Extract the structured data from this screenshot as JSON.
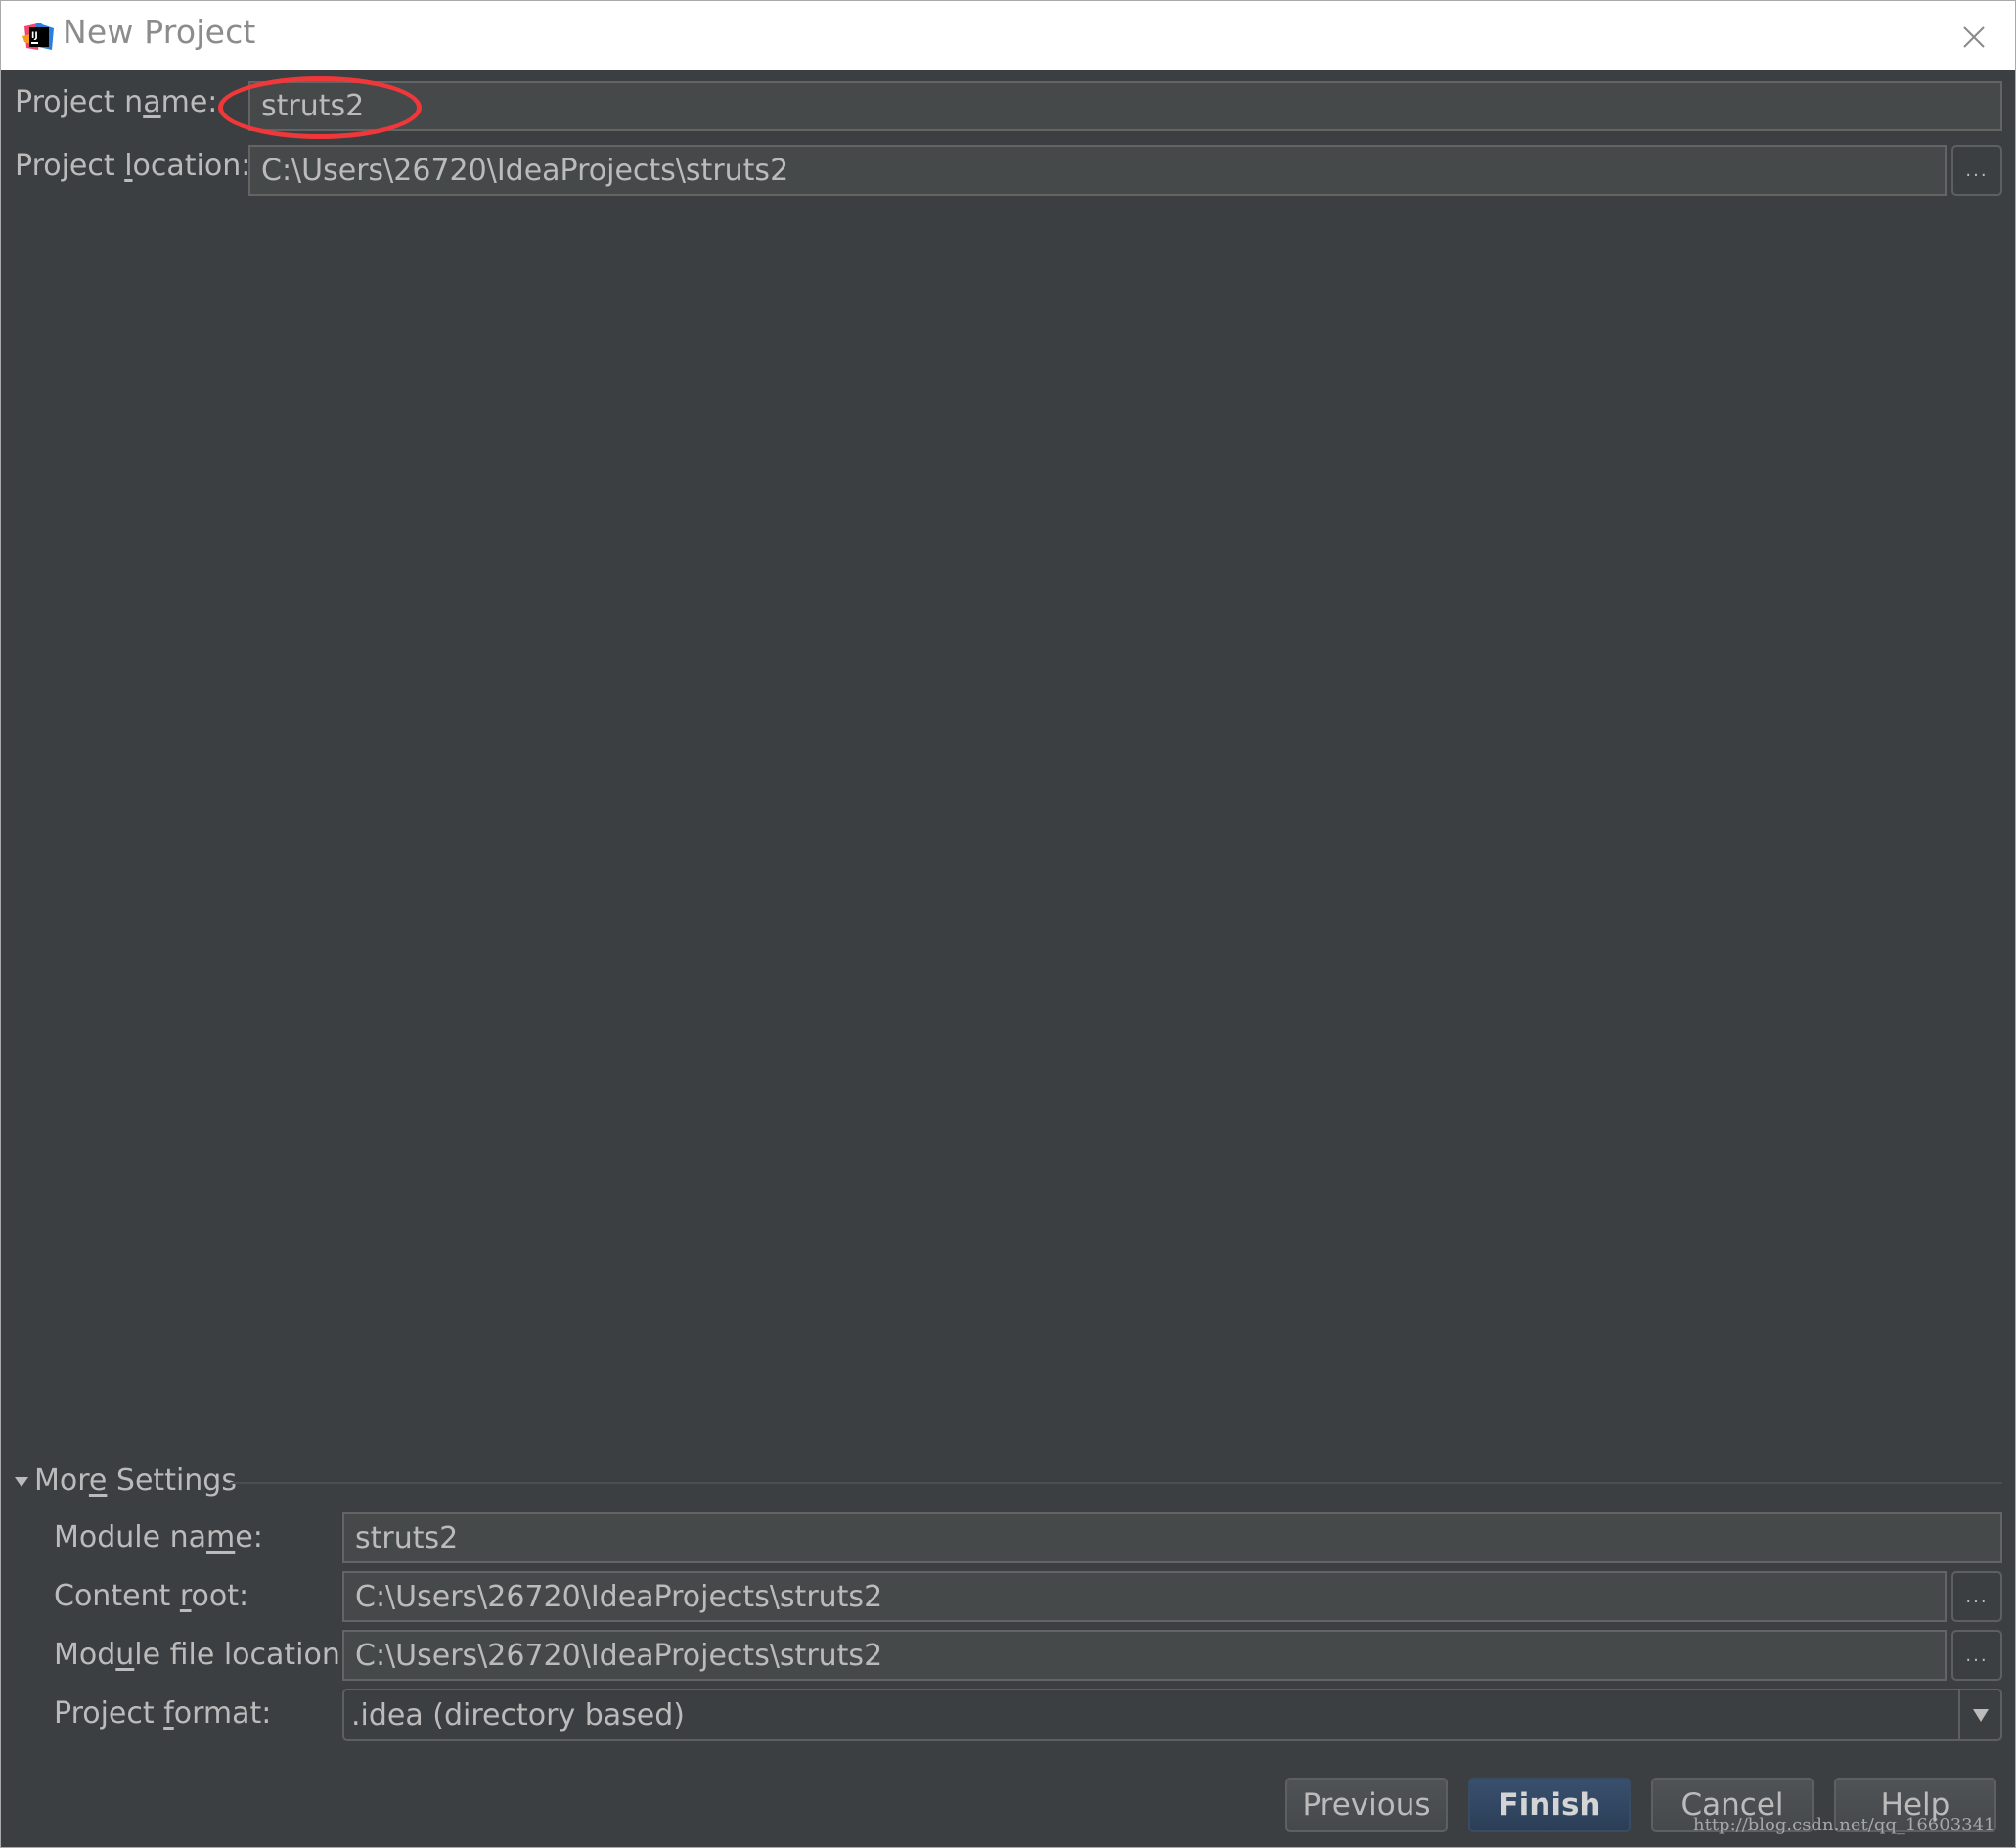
{
  "window": {
    "title": "New Project",
    "app_icon": "intellij-idea-icon",
    "close_icon": "close-icon"
  },
  "project": {
    "name_label_pre": "Project n",
    "name_label_mnemonic": "a",
    "name_label_post": "me:",
    "name_value": "struts2",
    "location_label_pre": "Project ",
    "location_label_mnemonic": "l",
    "location_label_post": "ocation:",
    "location_value": "C:\\Users\\26720\\IdeaProjects\\struts2",
    "browse_label": "...",
    "highlight_color": "#f0373a"
  },
  "more_settings": {
    "title_pre": "Mor",
    "title_mnemonic": "e",
    "title_post": " Settings",
    "expanded": true,
    "module_name_label_pre": "Module na",
    "module_name_label_mnemonic": "m",
    "module_name_label_post": "e:",
    "module_name_value": "struts2",
    "content_root_label_pre": "Content ",
    "content_root_label_mnemonic": "r",
    "content_root_label_post": "oot:",
    "content_root_value": "C:\\Users\\26720\\IdeaProjects\\struts2",
    "module_file_label_pre": "Mod",
    "module_file_label_mnemonic": "u",
    "module_file_label_post": "le file location:",
    "module_file_value": "C:\\Users\\26720\\IdeaProjects\\struts2",
    "format_label_pre": "Project ",
    "format_label_mnemonic": "f",
    "format_label_post": "ormat:",
    "format_value": ".idea (directory based)",
    "browse_label": "..."
  },
  "buttons": {
    "previous": "Previous",
    "finish": "Finish",
    "cancel": "Cancel",
    "help": "Help"
  },
  "watermark": "http://blog.csdn.net/qq_16603341"
}
